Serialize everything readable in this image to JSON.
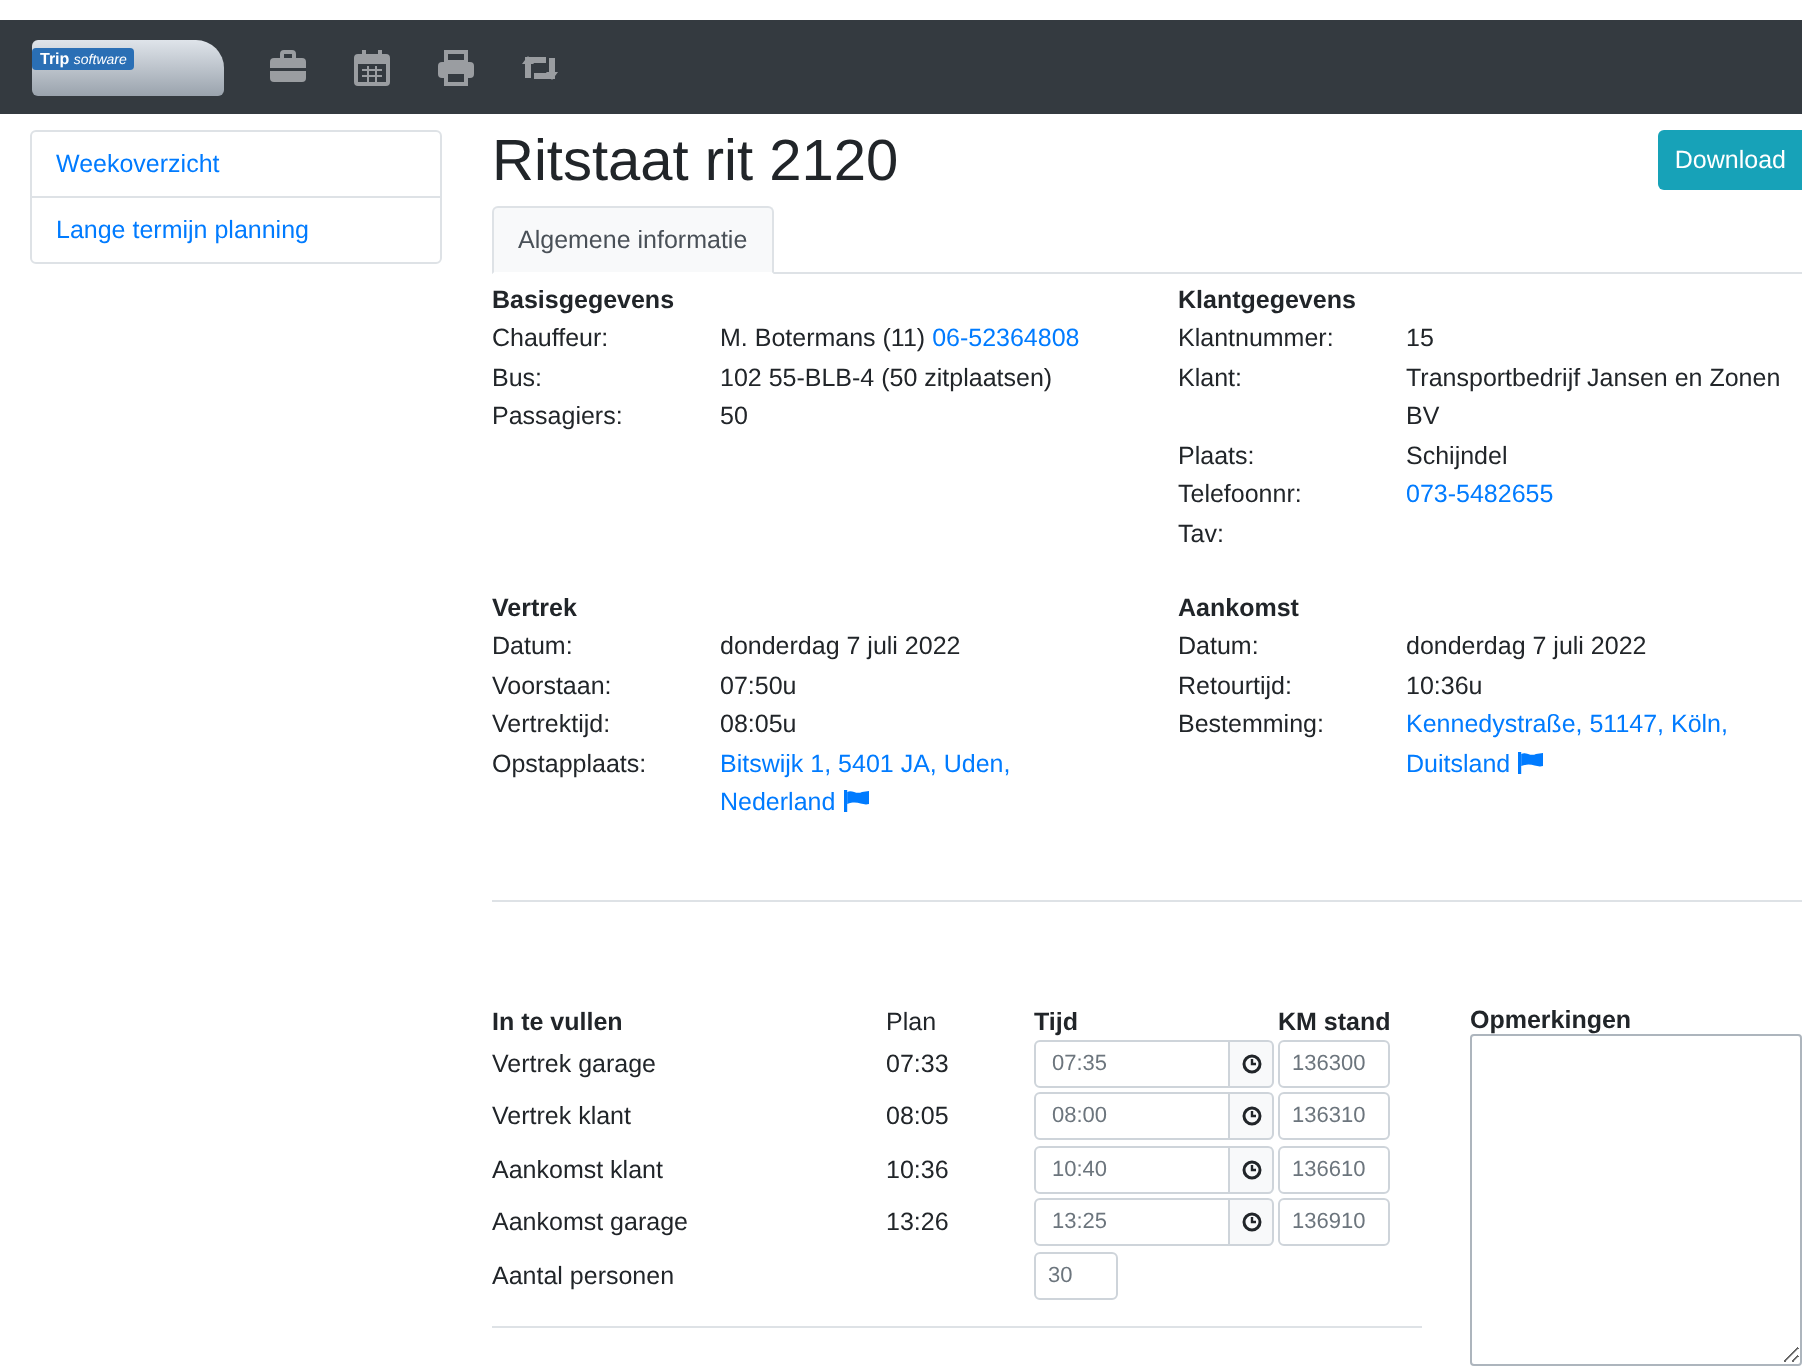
{
  "navbar": {
    "logo": {
      "word": "Trip",
      "sub": "software"
    },
    "icons": [
      {
        "kind": "briefcase"
      },
      {
        "kind": "calendar"
      },
      {
        "kind": "print"
      },
      {
        "kind": "retweet"
      }
    ]
  },
  "sidebar": {
    "items": [
      {
        "label": "Weekoverzicht"
      },
      {
        "label": "Lange termijn planning"
      }
    ]
  },
  "title": "Ritstaat rit 2120",
  "download_button": "Download",
  "tabs": [
    {
      "label": "Algemene informatie",
      "selected": true
    }
  ],
  "sections": [
    {
      "heading": "Basisgegevens",
      "rows": [
        {
          "label": "Chauffeur:",
          "value": [
            {
              "kind": "text",
              "text": "M. Botermans (11) "
            },
            {
              "kind": "link",
              "text": "06-52364808"
            }
          ]
        },
        {
          "label": "Bus:",
          "value": [
            {
              "kind": "text",
              "text": "102 55-BLB-4 (50 zitplaatsen)"
            }
          ]
        },
        {
          "label": "Passagiers:",
          "value": [
            {
              "kind": "text",
              "text": "50"
            }
          ]
        }
      ]
    },
    {
      "heading": "Klantgegevens",
      "rows": [
        {
          "label": "Klantnummer:",
          "value": [
            {
              "kind": "text",
              "text": "15"
            }
          ]
        },
        {
          "label": "Klant:",
          "value": [
            {
              "kind": "text",
              "text": "Transportbedrijf Jansen en Zonen BV"
            }
          ]
        },
        {
          "label": "Plaats:",
          "value": [
            {
              "kind": "text",
              "text": "Schijndel"
            }
          ]
        },
        {
          "label": "Telefoonnr:",
          "value": [
            {
              "kind": "link",
              "text": "073-5482655"
            }
          ]
        },
        {
          "label": "Tav:",
          "value": []
        }
      ]
    },
    {
      "heading": "Vertrek",
      "rows": [
        {
          "label": "Datum:",
          "value": [
            {
              "kind": "text",
              "text": "donderdag 7 juli 2022"
            }
          ]
        },
        {
          "label": "Voorstaan:",
          "value": [
            {
              "kind": "text",
              "text": "07:50u"
            }
          ]
        },
        {
          "label": "Vertrektijd:",
          "value": [
            {
              "kind": "text",
              "text": "08:05u"
            }
          ]
        },
        {
          "label": "Opstapplaats:",
          "value": [
            {
              "kind": "link",
              "text": "Bitswijk 1, 5401 JA, Uden, Nederland"
            }
          ],
          "flag": true
        }
      ]
    },
    {
      "heading": "Aankomst",
      "rows": [
        {
          "label": "Datum:",
          "value": [
            {
              "kind": "text",
              "text": "donderdag 7 juli 2022"
            }
          ]
        },
        {
          "label": "Retourtijd:",
          "value": [
            {
              "kind": "text",
              "text": "10:36u"
            }
          ]
        },
        {
          "label": "Bestemming:",
          "value": [
            {
              "kind": "link",
              "text": "Kennedystraße, 51147, Köln, Duitsland"
            }
          ],
          "flag": true
        }
      ]
    }
  ],
  "fill_in": {
    "columns": [
      "In te vullen",
      "Plan",
      "Tijd",
      "KM stand"
    ],
    "rows": [
      {
        "kind": "time",
        "label": "Vertrek garage",
        "plan": "07:33",
        "time": "07:35",
        "km": "136300"
      },
      {
        "kind": "time",
        "label": "Vertrek klant",
        "plan": "08:05",
        "time": "08:00",
        "km": "136310"
      },
      {
        "kind": "time",
        "label": "Aankomst klant",
        "plan": "10:36",
        "time": "10:40",
        "km": "136610"
      },
      {
        "kind": "time",
        "label": "Aankomst garage",
        "plan": "13:26",
        "time": "13:25",
        "km": "136910"
      },
      {
        "kind": "count",
        "label": "Aantal personen",
        "value": "30"
      }
    ]
  },
  "remarks": {
    "label": "Opmerkingen"
  }
}
